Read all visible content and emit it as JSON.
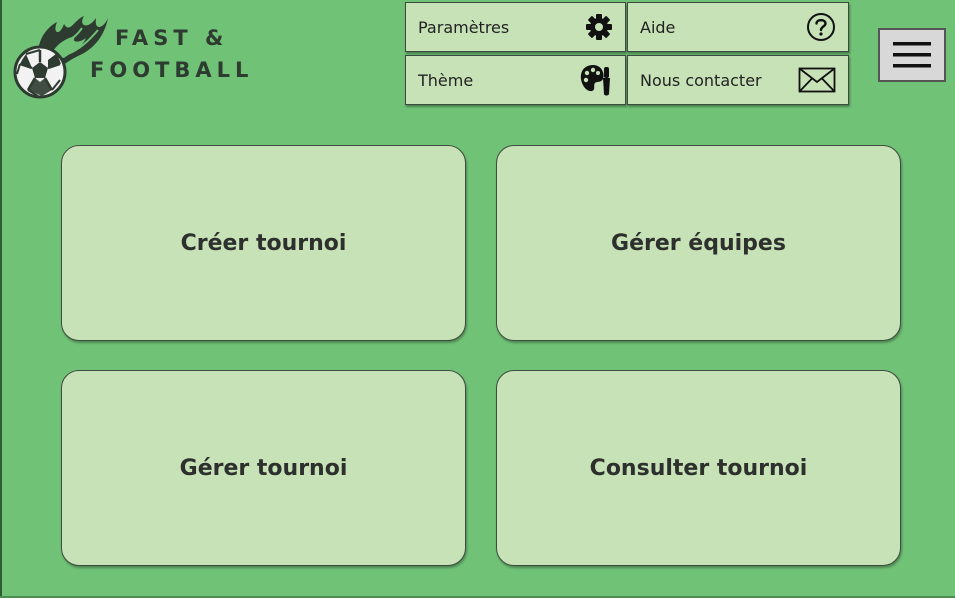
{
  "logo": {
    "line1": "FAST &",
    "line2": "FOOTBALL",
    "icon": "flaming-soccer-ball-icon"
  },
  "menu": {
    "parametres": {
      "label": "Paramètres",
      "icon": "gear-icon"
    },
    "aide": {
      "label": "Aide",
      "icon": "question-icon"
    },
    "theme": {
      "label": "Thème",
      "icon": "palette-icon"
    },
    "contact": {
      "label": "Nous contacter",
      "icon": "envelope-icon"
    }
  },
  "hamburger": {
    "icon": "hamburger-menu-icon"
  },
  "tiles": {
    "creer": "Créer tournoi",
    "gerer_equipes": "Gérer équipes",
    "gerer_tournoi": "Gérer tournoi",
    "consulter": "Consulter tournoi"
  },
  "colors": {
    "background": "#70c277",
    "panel": "#c7e2b7",
    "text": "#2d302d"
  }
}
